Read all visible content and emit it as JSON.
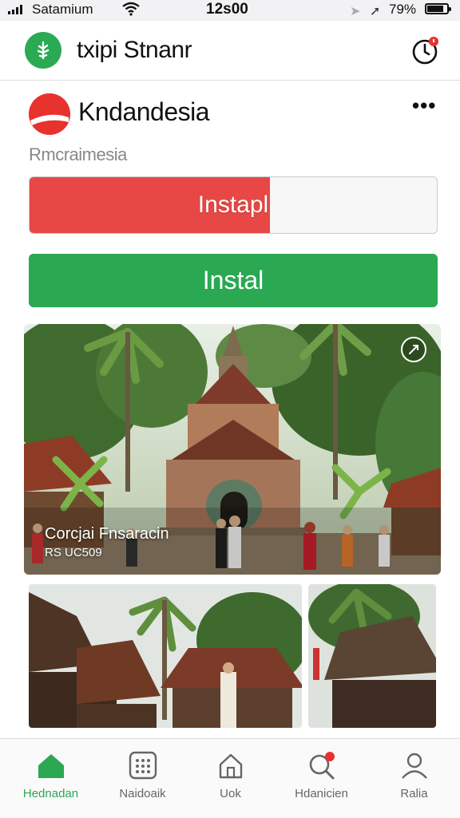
{
  "status_bar": {
    "carrier": "Satamium",
    "time": "12s00",
    "battery": "79%"
  },
  "header": {
    "title": "txipi Stnanr",
    "logo_icon": "leaf-icon",
    "action_icon": "timer-icon"
  },
  "app": {
    "name": "Kndandesia",
    "subtitle": "Rmcraimesia",
    "progress_label": "Instapl",
    "progress_fraction": 0.59,
    "install_label": "Instal",
    "more_label": "•••"
  },
  "hero": {
    "caption": "Corcjai Fnsaracin",
    "sub": "RS UC509"
  },
  "tabs": [
    {
      "label": "Hednadan",
      "icon": "home-icon",
      "active": true
    },
    {
      "label": "Naidoaik",
      "icon": "grid-icon",
      "active": false
    },
    {
      "label": "Uok",
      "icon": "house-outline-icon",
      "active": false
    },
    {
      "label": "Hdanicien",
      "icon": "search-icon",
      "active": false
    },
    {
      "label": "Ralia",
      "icon": "user-icon",
      "active": false
    }
  ],
  "colors": {
    "accent_green": "#2aa852",
    "accent_red": "#e84845"
  }
}
